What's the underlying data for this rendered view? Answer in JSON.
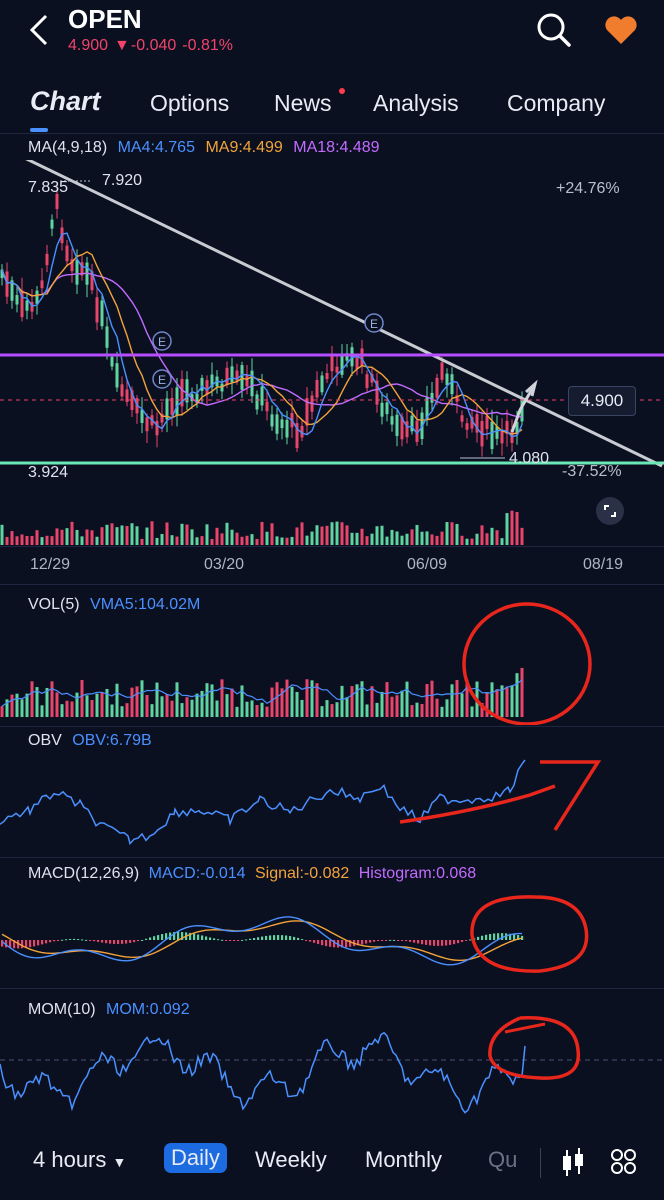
{
  "header": {
    "ticker": "OPEN",
    "price": "4.900",
    "change": "-0.040",
    "change_pct": "-0.81%",
    "change_arrow": "▼"
  },
  "tabs": [
    {
      "label": "Chart",
      "active": true
    },
    {
      "label": "Options"
    },
    {
      "label": "News",
      "has_dot": true
    },
    {
      "label": "Analysis"
    },
    {
      "label": "Company"
    }
  ],
  "main_chart": {
    "ma_label": "MA(4,9,18)",
    "ma4": "MA4:4.765",
    "ma9": "MA9:4.499",
    "ma18": "MA18:4.489",
    "high_a": "7.835",
    "high_b": "7.920",
    "low_a": "3.924",
    "low_b": "4.080",
    "pct_up": "+24.76%",
    "pct_down": "-37.52%",
    "current_price": "4.900",
    "earnings_marker": "E",
    "dates": [
      "12/29",
      "03/20",
      "06/09",
      "08/19"
    ]
  },
  "indicators": {
    "vol_label": "VOL(5)",
    "vma": "VMA5:104.02M",
    "obv_label": "OBV",
    "obv": "OBV:6.79B",
    "macd_label": "MACD(12,26,9)",
    "macd": "MACD:-0.014",
    "signal": "Signal:-0.082",
    "histogram": "Histogram:0.068",
    "mom_label": "MOM(10)",
    "mom": "MOM:0.092"
  },
  "bottom_bar": {
    "periods": [
      {
        "label": "4 hours",
        "dropdown": true
      },
      {
        "label": "Daily",
        "active": true
      },
      {
        "label": "Weekly"
      },
      {
        "label": "Monthly"
      },
      {
        "label": "Qu"
      }
    ]
  },
  "colors": {
    "background": "#0b1020",
    "up": "#5fd3a0",
    "down": "#e8456b",
    "ma4": "#4a90ff",
    "ma9": "#f2a33a",
    "ma18": "#c26bff",
    "resistance": "#b64dff",
    "support": "#6ee7b7",
    "annotation": "#e8261c"
  }
}
